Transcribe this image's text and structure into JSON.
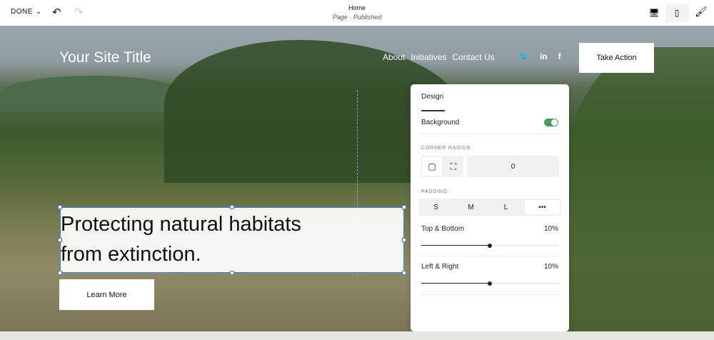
{
  "toolbar": {
    "done": "DONE",
    "page_title": "Home",
    "page_status": "Page · Published"
  },
  "site": {
    "title": "Your Site Title",
    "nav": [
      "About",
      "Initiatives",
      "Contact Us"
    ],
    "social": [
      "twitter",
      "in",
      "f"
    ],
    "cta": "Take Action",
    "headline_1": "Protecting natural habitats",
    "headline_2": "from extinction.",
    "button": "Learn More"
  },
  "panel": {
    "tab": "Design",
    "background_label": "Background",
    "background_on": true,
    "corner_radius_label": "CORNER RADIUS",
    "corner_radius_value": "0",
    "padding_label": "PADDING",
    "padding_options": [
      "S",
      "M",
      "L",
      "•••"
    ],
    "padding_selected": "•••",
    "top_bottom_label": "Top & Bottom",
    "top_bottom_value": "10%",
    "top_bottom_fraction": 0.5,
    "left_right_label": "Left & Right",
    "left_right_value": "10%",
    "left_right_fraction": 0.5
  }
}
